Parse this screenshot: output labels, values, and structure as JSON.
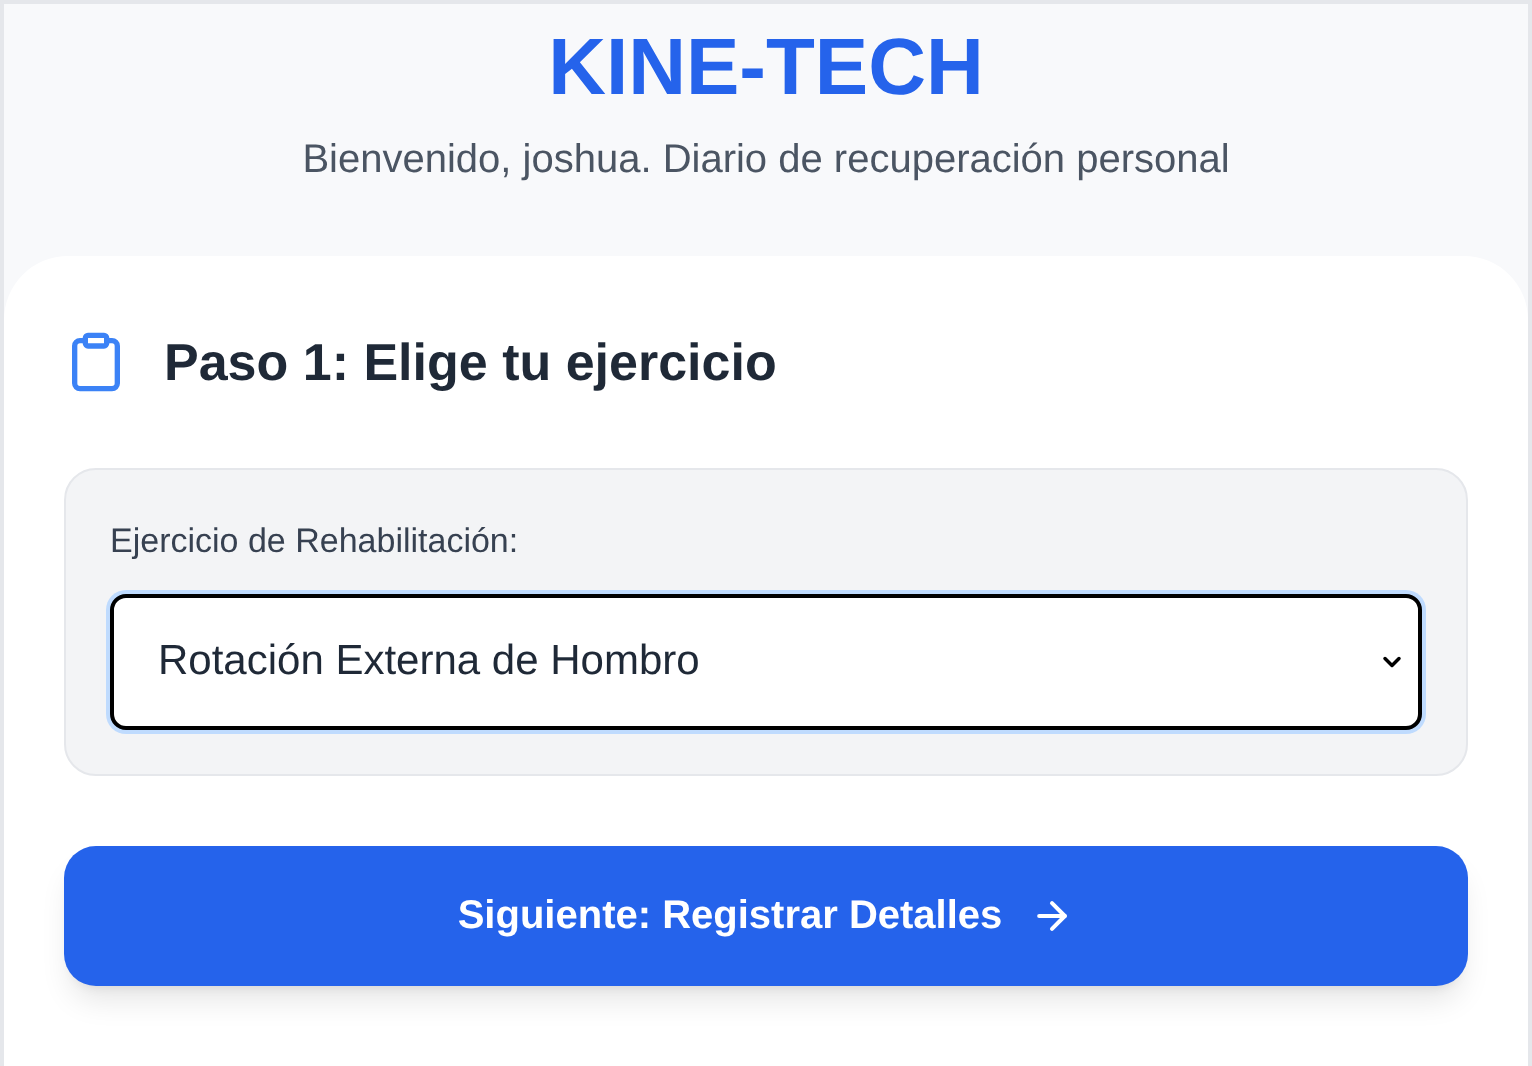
{
  "header": {
    "title": "KINE-TECH",
    "subtitle": "Bienvenido, joshua. Diario de recuperación personal"
  },
  "step": {
    "title": "Paso 1: Elige tu ejercicio"
  },
  "exercise_field": {
    "label": "Ejercicio de Rehabilitación:",
    "value": "Rotación Externa de Hombro"
  },
  "next_button": {
    "label": "Siguiente: Registrar Detalles"
  }
}
